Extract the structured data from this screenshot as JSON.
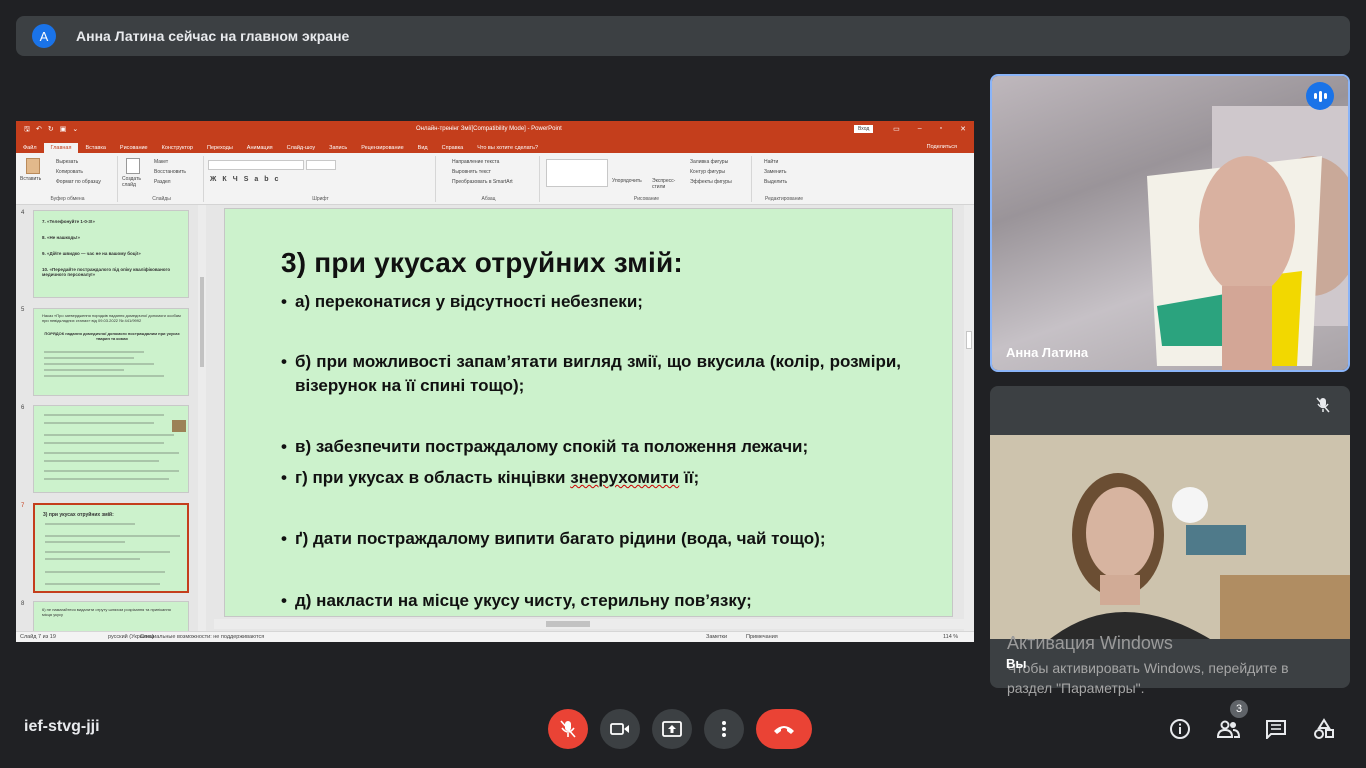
{
  "banner": {
    "avatar_letter": "A",
    "text": "Анна Латина сейчас на главном экране"
  },
  "ppt": {
    "window_title": "Онлайн-тренінг Змії[Compatibility Mode] - PowerPoint",
    "login": "Вход",
    "tabs": [
      "Файл",
      "Главная",
      "Вставка",
      "Рисование",
      "Конструктор",
      "Переходы",
      "Анимация",
      "Слайд-шоу",
      "Запись",
      "Рецензирование",
      "Вид",
      "Справка"
    ],
    "tell_me": "Что вы хотите сделать?",
    "share": "Поделиться",
    "ribbon": {
      "paste": "Вставить",
      "cut": "Вырезать",
      "copy": "Копировать",
      "format_painter": "Формат по образцу",
      "clipboard": "Буфер обмена",
      "new_slide": "Создать слайд",
      "layout": "Макет",
      "reset": "Восстановить",
      "section": "Раздел",
      "slides": "Слайды",
      "font": "Шрифт",
      "text_direction": "Направление текста",
      "align_text": "Выровнять текст",
      "smartart": "Преобразовать в SmartArt",
      "paragraph": "Абзац",
      "arrange": "Упорядочить",
      "quick_styles": "Экспресс-стили",
      "shape_fill": "Заливка фигуры",
      "shape_outline": "Контур фигуры",
      "shape_effects": "Эффекты фигуры",
      "drawing": "Рисование",
      "find": "Найти",
      "replace": "Заменить",
      "select": "Выделить",
      "editing": "Редактирование"
    },
    "thumbs": [
      {
        "num": "4",
        "lines": [
          "7. «Телефонуйте 1-0-3!»",
          "8. «Не нашкодь!»",
          "9. «Дійте швидко — час не на вашому боці!»",
          "10. «Передайте постраждалого під опіку кваліфікованого медичного персоналу!»"
        ]
      },
      {
        "num": "5",
        "lines": [
          "Наказ «Про затвердження порядків надання домедичної допомоги особам при невідкладних станах» від 09.03.2022 № 441/9992",
          "ПОРЯДОК надання домедичної допомоги постраждалим при укусах тварин та комах"
        ]
      },
      {
        "num": "6",
        "lines": []
      },
      {
        "num": "7",
        "lines": [
          "3) при укусах отруйних змій:"
        ]
      },
      {
        "num": "8",
        "lines": [
          "6) не намагайтеся видалити отруту шляхом розрізання та припікання місця укусу"
        ]
      }
    ],
    "slide": {
      "title": "3) при укусах отруйних змій:",
      "bullets": [
        {
          "marker": "•",
          "text": "а) переконатися у відсутності небезпеки;"
        },
        {
          "marker": "•",
          "text": "б) при можливості запам’ятати вигляд змії, що вкусила (колір, розміри, візерунок на її спині тощо);"
        },
        {
          "marker": "•",
          "text": "в) забезпечити постраждалому спокій та положення лежачи;"
        },
        {
          "marker": "•",
          "text_pre": "г) при укусах в область кінцівки ",
          "text_err": "знерухомити",
          "text_post": " її;"
        },
        {
          "marker": "•",
          "text": "ґ) дати постраждалому випити багато рідини (вода, чай тощо);"
        },
        {
          "marker": "•",
          "text": "д) накласти на місце укусу чисту, стерильну пов’язку;"
        }
      ]
    },
    "status": {
      "slide_of": "Слайд 7 из 19",
      "language": "русский (Украина)",
      "accessibility": "Специальные возможности: не поддерживаются",
      "notes": "Заметки",
      "comments": "Примечания",
      "zoom": "114 %"
    }
  },
  "tiles": {
    "presenter_name": "Анна Латина",
    "self_name": "Вы"
  },
  "windows_activation": {
    "title": "Активация Windows",
    "text": "Чтобы активировать Windows, перейдите в раздел \"Параметры\"."
  },
  "meeting": {
    "code": "ief-stvg-jji",
    "participants_count": "3"
  },
  "colors": {
    "background": "#202124",
    "ppt_accent": "#c43e1c",
    "slide_bg": "#ccf2cc",
    "hangup": "#ea4335",
    "active_speaker": "#8ab4f8"
  }
}
